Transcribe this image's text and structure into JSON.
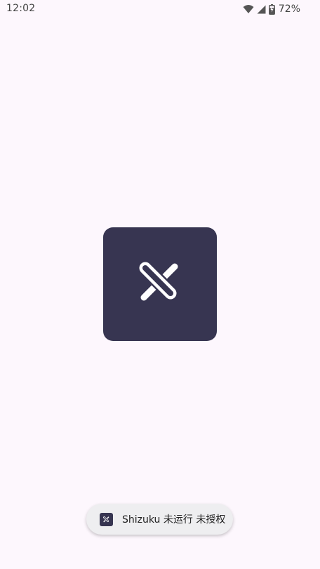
{
  "status_bar": {
    "time": "12:02",
    "battery_percent": "72%",
    "icons": [
      "wifi-icon",
      "cellular-signal-icon",
      "battery-charging-icon"
    ]
  },
  "splash": {
    "logo": "shizuku-logo-icon",
    "background_color": "#373551"
  },
  "toast": {
    "icon": "shizuku-logo-icon",
    "message": "Shizuku 未运行 未授权"
  },
  "colors": {
    "background": "#fdf7fd",
    "logo_background": "#373551",
    "toast_background": "#eeeef0"
  }
}
